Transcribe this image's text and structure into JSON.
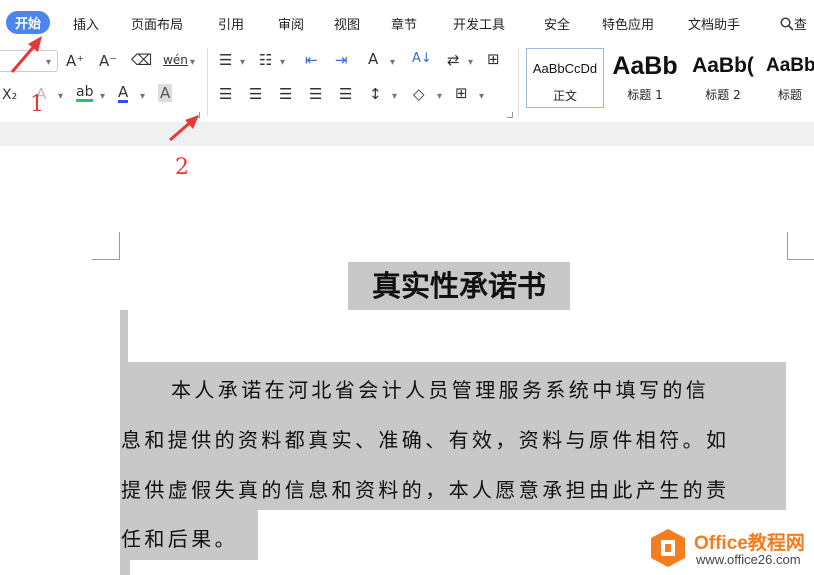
{
  "tabs": [
    "开始",
    "插入",
    "页面布局",
    "引用",
    "审阅",
    "视图",
    "章节",
    "开发工具",
    "安全",
    "特色应用",
    "文档助手",
    "查"
  ],
  "active_tab": "开始",
  "ribbon": {
    "font_size_up": "A⁺",
    "font_size_down": "A⁻",
    "pinyin": "wén",
    "subscript": "X₂",
    "highlight": "ab",
    "font_color": "A",
    "char_shading": "A",
    "sort": "A↓"
  },
  "styles": [
    {
      "sample": "AaBbCcDd",
      "name": "正文"
    },
    {
      "sample": "AaBb",
      "name": "标题 1"
    },
    {
      "sample": "AaBb(",
      "name": "标题 2"
    },
    {
      "sample": "AaBb",
      "name": "标题"
    }
  ],
  "annotations": {
    "one": "1",
    "two": "2"
  },
  "document": {
    "title": "真实性承诺书",
    "lines": [
      "本人承诺在河北省会计人员管理服务系统中填写的信",
      "息和提供的资料都真实、准确、有效，资料与原件相符。如",
      "提供虚假失真的信息和资料的，本人愿意承担由此产生的责",
      "任和后果。"
    ]
  },
  "watermark": {
    "brand": "Office教程网",
    "url": "www.office26.com"
  },
  "colors": {
    "accent": "#4a86ee",
    "annotation": "#e53935",
    "selection": "#c8c8c8",
    "brand": "#f47d20"
  }
}
